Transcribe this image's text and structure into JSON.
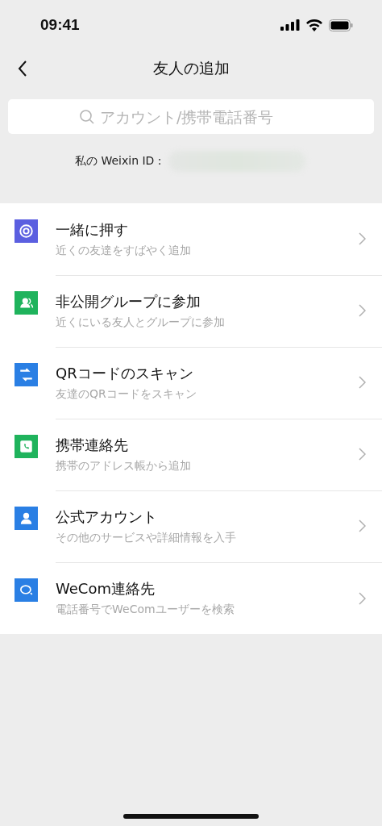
{
  "status_bar": {
    "time": "09:41"
  },
  "nav": {
    "title": "友人の追加"
  },
  "search": {
    "placeholder": "アカウント/携帯電話番号"
  },
  "my_id": {
    "label": "私の Weixin ID :"
  },
  "items": [
    {
      "kind": "radar",
      "color": "#5b5fe0",
      "title": "一緒に押す",
      "subtitle": "近くの友達をすばやく追加"
    },
    {
      "kind": "group",
      "color": "#1fb35c",
      "title": "非公開グループに参加",
      "subtitle": "近くにいる友人とグループに参加"
    },
    {
      "kind": "scan",
      "color": "#2a7fe4",
      "title": "QRコードのスキャン",
      "subtitle": "友達のQRコードをスキャン"
    },
    {
      "kind": "phone",
      "color": "#1fb35c",
      "title": "携帯連絡先",
      "subtitle": "携帯のアドレス帳から追加"
    },
    {
      "kind": "person",
      "color": "#2a7fe4",
      "title": "公式アカウント",
      "subtitle": "その他のサービスや詳細情報を入手"
    },
    {
      "kind": "chat",
      "color": "#2a7fe4",
      "title": "WeCom連絡先",
      "subtitle": "電話番号でWeComユーザーを検索"
    }
  ]
}
